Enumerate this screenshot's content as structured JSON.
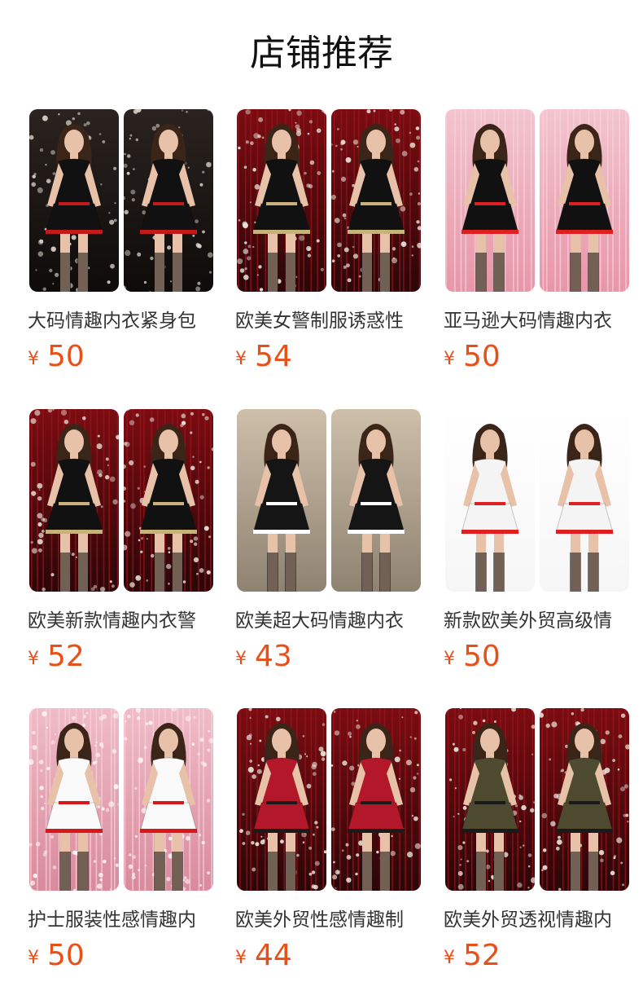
{
  "header": {
    "title": "店铺推荐"
  },
  "products": [
    {
      "name": "大码情趣内衣紧身包",
      "currency": "¥",
      "price": "50",
      "theme": "dots",
      "accent": "#111111",
      "trim": "#c01a1a"
    },
    {
      "name": "欧美女警制服诱惑性",
      "currency": "¥",
      "price": "54",
      "theme": "red",
      "accent": "#111111",
      "trim": "#c9b27a"
    },
    {
      "name": "亚马逊大码情趣内衣",
      "currency": "¥",
      "price": "50",
      "theme": "pink",
      "accent": "#111111",
      "trim": "#e02020"
    },
    {
      "name": "欧美新款情趣内衣警",
      "currency": "¥",
      "price": "52",
      "theme": "red",
      "accent": "#111111",
      "trim": "#c9b27a"
    },
    {
      "name": "欧美超大码情趣内衣",
      "currency": "¥",
      "price": "43",
      "theme": "beige",
      "accent": "#151515",
      "trim": "#ffffff"
    },
    {
      "name": "新款欧美外贸高级情",
      "currency": "¥",
      "price": "50",
      "theme": "white",
      "accent": "#f4f4f4",
      "trim": "#e02020"
    },
    {
      "name": "护士服装性感情趣内",
      "currency": "¥",
      "price": "50",
      "theme": "pinkdots",
      "accent": "#fafafa",
      "trim": "#d81818"
    },
    {
      "name": "欧美外贸性感情趣制",
      "currency": "¥",
      "price": "44",
      "theme": "red",
      "accent": "#b3172a",
      "trim": "#1a1a1a"
    },
    {
      "name": "欧美外贸透视情趣内",
      "currency": "¥",
      "price": "52",
      "theme": "red",
      "accent": "#4e4a30",
      "trim": "#1a1a1a"
    }
  ]
}
